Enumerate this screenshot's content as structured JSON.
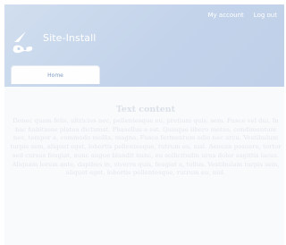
{
  "header": {
    "site_name": "Site-Install",
    "secondary_menu": {
      "account": "My account",
      "logout": "Log out"
    }
  },
  "tabs": [
    {
      "label": "Home"
    }
  ],
  "content": {
    "title": "Text content",
    "body": "Donec quam felis, ultricies nec, pellentesque eu, pretium quis, sem. Fusce vel dui. In hac habitasse platea dictumst. Phasellus a est. Quisque libero metus, condimentum nec, tempor a, commodo mollis, magna. Fusce fermentum odio nec arcu. Vestibulum turpis sem, aliquet eget, lobortis pellentesque, rutrum eu, nisl. Aenean posuere, tortor sed cursus feugiat, nunc augue blandit nunc, eu sollicitudin urna dolor sagittis lacus. Aliquam lorem ante, dapibus in, viverra quis, feugiat a, tellus. Vestibulum turpis sem, aliquet eget, lobortis pellentesque, rutrum eu, nisl."
  },
  "colors": {
    "header_gradient_start": "#d1deef",
    "header_gradient_end": "#bfd0e8",
    "tab_text": "#7e9ac2",
    "content_text": "#e3e7ee"
  }
}
